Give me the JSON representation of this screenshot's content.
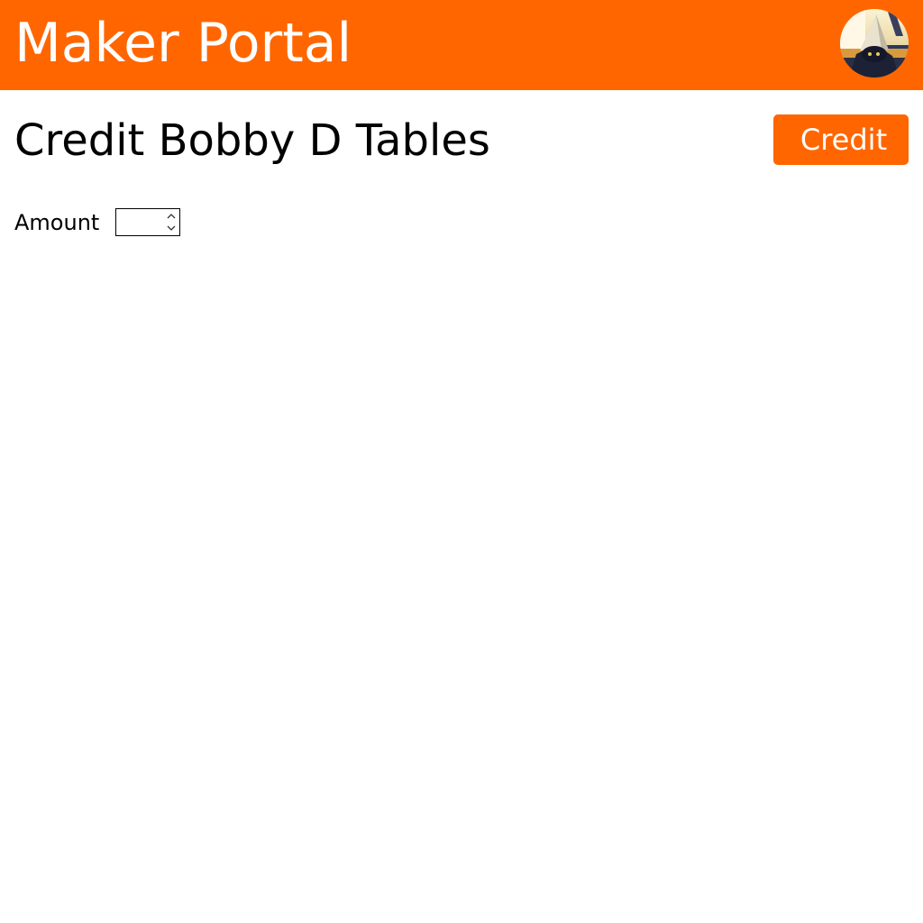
{
  "header": {
    "app_title": "Maker Portal",
    "background_color": "#ff6600",
    "avatar_icon": "user-avatar"
  },
  "main": {
    "page_title": "Credit Bobby D Tables",
    "credit_button_label": "Credit",
    "amount_label": "Amount",
    "amount_value": "",
    "accent_color": "#ff6600"
  }
}
